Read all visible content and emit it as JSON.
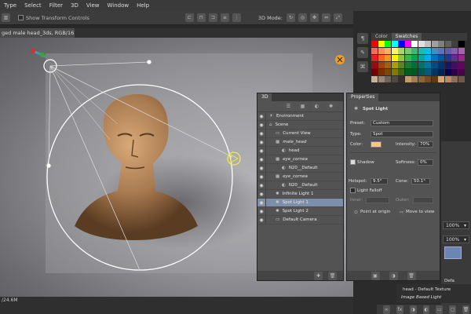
{
  "menu": [
    "Type",
    "Select",
    "Filter",
    "3D",
    "View",
    "Window",
    "Help"
  ],
  "options": {
    "show_transform": "Show Transform Controls",
    "mode_label": "3D Mode:",
    "workspace": "3D"
  },
  "document": {
    "tab_title": "ged male head_3ds, RGB/16) *",
    "status": "/24.6M"
  },
  "color_panel": {
    "tabs": [
      "Color",
      "Swatches"
    ]
  },
  "panel3d": {
    "title": "3D",
    "rows": [
      {
        "label": "Environment",
        "indent": 0,
        "icon": "env"
      },
      {
        "label": "Scene",
        "indent": 0,
        "icon": "scene"
      },
      {
        "label": "Current View",
        "indent": 1,
        "icon": "camera"
      },
      {
        "label": "male_head",
        "indent": 1,
        "icon": "mesh"
      },
      {
        "label": "head",
        "indent": 2,
        "icon": "mat"
      },
      {
        "label": "eye_cornea",
        "indent": 1,
        "icon": "mesh"
      },
      {
        "label": "N20__Default",
        "indent": 2,
        "icon": "mat"
      },
      {
        "label": "eye_cornea",
        "indent": 1,
        "icon": "mesh"
      },
      {
        "label": "N20__Default",
        "indent": 2,
        "icon": "mat"
      },
      {
        "label": "Infinite Light 1",
        "indent": 1,
        "icon": "light"
      },
      {
        "label": "Spot Light 1",
        "indent": 1,
        "icon": "light",
        "selected": true
      },
      {
        "label": "Spot Light 2",
        "indent": 1,
        "icon": "light"
      },
      {
        "label": "Default Camera",
        "indent": 1,
        "icon": "camera"
      }
    ]
  },
  "properties": {
    "tab": "Properties",
    "title": "Spot Light",
    "preset_label": "Preset:",
    "preset": "Custom",
    "type_label": "Type:",
    "type": "Spot",
    "color_label": "Color:",
    "intensity_label": "Intensity:",
    "intensity": "70%",
    "shadow_label": "Shadow",
    "softness_label": "Softness:",
    "softness": "0%",
    "hotspot_label": "Hotspot:",
    "hotspot": "9.5°",
    "cone_label": "Cone:",
    "cone": "50.1°",
    "falloff_label": "Light Falloff",
    "inner_label": "Inner:",
    "outer_label": "Outer:",
    "point_origin": "Point at origin",
    "move_view": "Move to view",
    "light_color": "#f6c48c"
  },
  "right_strip": {
    "pct1": "100%",
    "pct2": "100%",
    "defa": "Defa",
    "head_texture": "head - Default Texture",
    "ibl": "Image Based Light"
  }
}
